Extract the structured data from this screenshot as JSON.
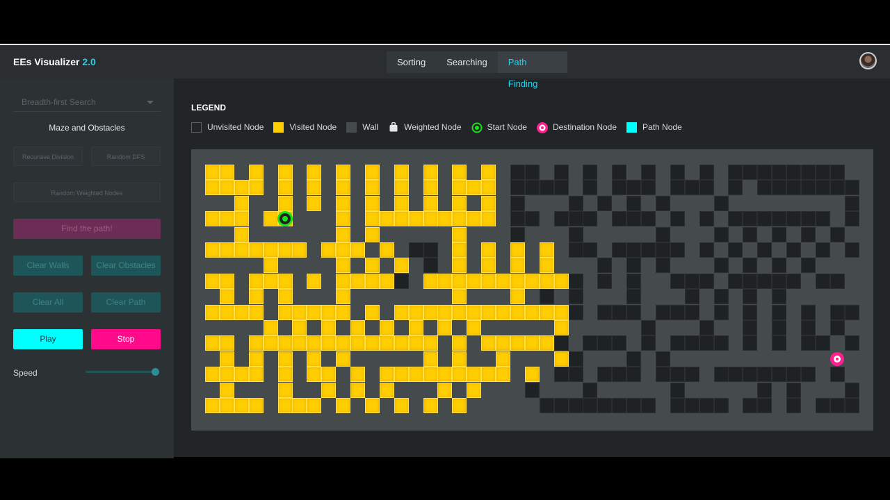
{
  "app": {
    "title": "EEs Visualizer",
    "version": "2.0"
  },
  "tabs": [
    {
      "label": "Sorting",
      "active": false
    },
    {
      "label": "Searching",
      "active": false
    },
    {
      "label": "Path Finding",
      "active": true
    }
  ],
  "sidebar": {
    "algorithm_select": {
      "value": "Breadth-first Search"
    },
    "maze_title": "Maze and Obstacles",
    "recursive_division": "Recursive Division",
    "random_dfs": "Random DFS",
    "random_weighted": "Random Weighted Nodes",
    "find_path": "Find the path!",
    "clear_walls": "Clear Walls",
    "clear_obstacles": "Clear Obstacles",
    "clear_all": "Clear All",
    "clear_path": "Clear Path",
    "play": "Play",
    "stop": "Stop",
    "speed_label": "Speed",
    "speed_value": 1.0
  },
  "legend": {
    "title": "LEGEND",
    "items": [
      {
        "label": "Unvisited Node",
        "kind": "unvisited"
      },
      {
        "label": "Visited Node",
        "kind": "visited"
      },
      {
        "label": "Wall",
        "kind": "wall"
      },
      {
        "label": "Weighted Node",
        "kind": "weight"
      },
      {
        "label": "Start Node",
        "kind": "start"
      },
      {
        "label": "Destination Node",
        "kind": "destination"
      },
      {
        "label": "Path Node",
        "kind": "path"
      }
    ]
  },
  "colors": {
    "accent": "#22d3ee",
    "visited": "#ffce00",
    "wall": "#1f2224",
    "start": "#17e317",
    "destination": "#ff1f8f",
    "path": "#00ffff",
    "unvisited": "#454a4d"
  },
  "grid": {
    "rows": 17,
    "cols": 45,
    "start": {
      "row": 3,
      "col": 5
    },
    "destination": {
      "row": 12,
      "col": 43
    },
    "cells": [
      "VV.V.V.V.V.V.V.V.V.V.WW.W.W.W.W.W.W.WWWWWWWW.W",
      "VVVV.V.V.V.V.V.V.VVV.WWWW.W.WWW.WWW.W.WWWWWWWW.W",
      "..V..V.V.V.V.V.V.V.V.W...W.W.W.W...W........W.W",
      "VVV.VV...V.VVVVVVVVV.WW.WWW.WWW.W.W.WWWWWWW.W.W",
      "..V......V.V.....V...W...W.....W...W.W.W.W.W...",
      "VVVVVVV.VVV.V.WW.V.V.V.V.WW.WWWWW.W.W.W.W.W.W.W",
      "....V....V.V.V.W.V.V.V.V...W.W.W...W.W.W.W...W.",
      "VV.VVV.V.VVVVW.VVVVVVVVVVW.W.W..WWW.WWWWW.WW.W.",
      ".V.V.V...V.......V...V.W.W...W...W.W.W.W.....W.",
      "VVVV.VVVVV.V.VVVVVVVVVVVVW.WWW.WWW.W.W.W.W.WW.W",
      "....V.V.V.V.V.V.V.V.....V.....W...W..W.W.W.W...",
      "VV.VVVVVVVVVVVVV.V.VVVVVW.WWW.W.WWWW.W.W.WW.W.W",
      ".V.V.V.V.V.....V.V..V...VW...W.W...............",
      "VVVV.V.VV.V.VVVVVVVVV.V.WW.WWW.WWW.WWWWWWW.W.W",
      ".V...V..V.V.V...V.V...W...W.....W.....W.W...W.",
      "VVVV.VVV.V.V.V.V.V.....WWWWWWWW.WWWW.WW.W.WWWWW",
      "................................................"
    ]
  }
}
